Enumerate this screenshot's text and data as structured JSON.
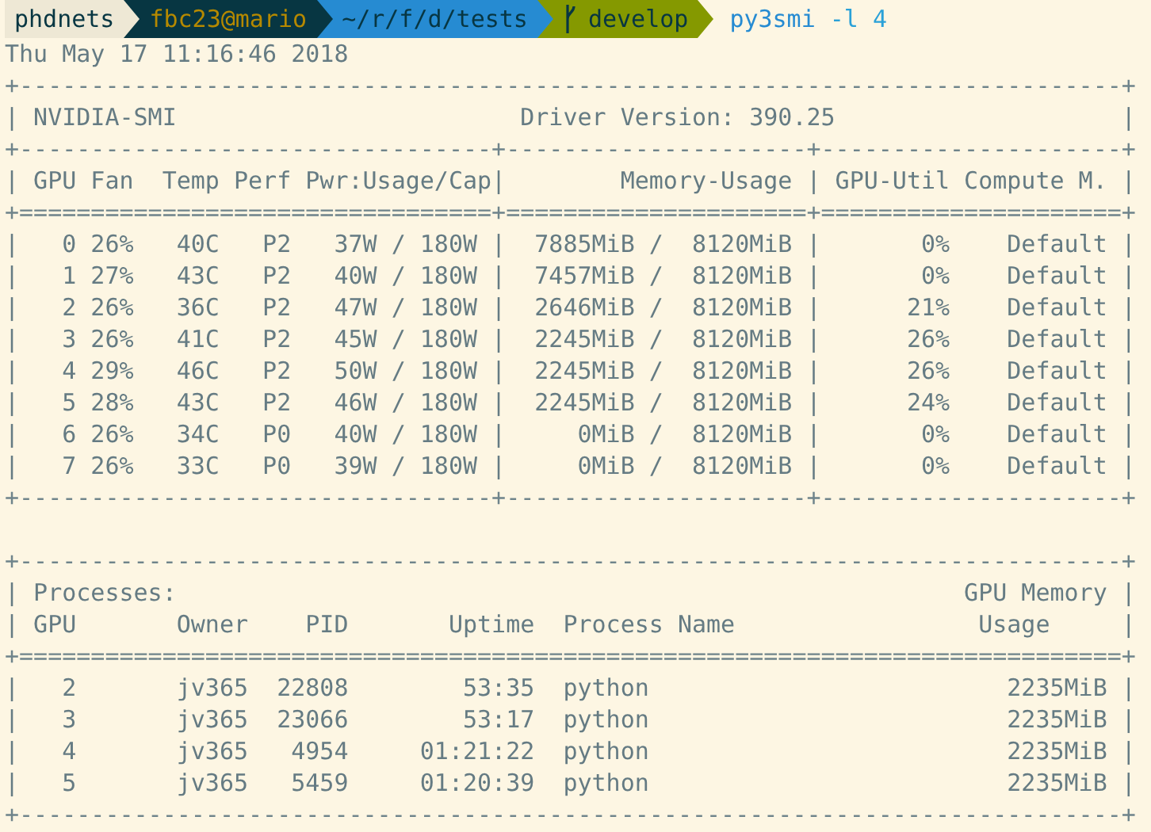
{
  "prompt": {
    "segments": [
      {
        "kind": "host",
        "text": "phdnets",
        "color": "#eee8d5"
      },
      {
        "kind": "user",
        "text": "fbc23@mario",
        "color": "#073642"
      },
      {
        "kind": "path",
        "text": "~/r/f/d/tests",
        "color": "#268bd2"
      },
      {
        "kind": "git",
        "text": "develop",
        "color": "#859900"
      }
    ],
    "command": "py3smi",
    "arguments": "-l 4"
  },
  "date": "Thu May 17 11:16:46 2018",
  "gpu_table": {
    "lines": [
      {
        "kind": "border",
        "text": "+-----------------------------------------------------------------------------+"
      },
      {
        "kind": "row",
        "text": "| NVIDIA-SMI                        Driver Version: 390.25                    |"
      },
      {
        "kind": "border",
        "text": "+---------------------------------+---------------------+---------------------+"
      },
      {
        "kind": "row",
        "text": "| GPU Fan  Temp Perf Pwr:Usage/Cap|        Memory-Usage | GPU-Util Compute M. |"
      },
      {
        "kind": "border",
        "text": "+=================================+=====================+=====================+"
      },
      {
        "kind": "row",
        "text": "|   0 26%   40C   P2   37W / 180W |  7885MiB /  8120MiB |       0%    Default |"
      },
      {
        "kind": "row",
        "text": "|   1 27%   43C   P2   40W / 180W |  7457MiB /  8120MiB |       0%    Default |"
      },
      {
        "kind": "row",
        "text": "|   2 26%   36C   P2   47W / 180W |  2646MiB /  8120MiB |      21%    Default |"
      },
      {
        "kind": "row",
        "text": "|   3 26%   41C   P2   45W / 180W |  2245MiB /  8120MiB |      26%    Default |"
      },
      {
        "kind": "row",
        "text": "|   4 29%   46C   P2   50W / 180W |  2245MiB /  8120MiB |      26%    Default |"
      },
      {
        "kind": "row",
        "text": "|   5 28%   43C   P2   46W / 180W |  2245MiB /  8120MiB |      24%    Default |"
      },
      {
        "kind": "row",
        "text": "|   6 26%   34C   P0   40W / 180W |     0MiB /  8120MiB |       0%    Default |"
      },
      {
        "kind": "row",
        "text": "|   7 26%   33C   P0   39W / 180W |     0MiB /  8120MiB |       0%    Default |"
      },
      {
        "kind": "border",
        "text": "+---------------------------------+---------------------+---------------------+"
      }
    ]
  },
  "process_table": {
    "lines": [
      {
        "kind": "border",
        "text": "+-----------------------------------------------------------------------------+"
      },
      {
        "kind": "row",
        "text": "| Processes:                                                       GPU Memory |"
      },
      {
        "kind": "row",
        "text": "| GPU       Owner    PID       Uptime  Process Name                 Usage     |"
      },
      {
        "kind": "border",
        "text": "+=============================================================================+"
      },
      {
        "kind": "row",
        "text": "|   2       jv365  22808        53:35  python                         2235MiB |"
      },
      {
        "kind": "row",
        "text": "|   3       jv365  23066        53:17  python                         2235MiB |"
      },
      {
        "kind": "row",
        "text": "|   4       jv365   4954     01:21:22  python                         2235MiB |"
      },
      {
        "kind": "row",
        "text": "|   5       jv365   5459     01:20:39  python                         2235MiB |"
      },
      {
        "kind": "border",
        "text": "+-----------------------------------------------------------------------------+"
      }
    ]
  }
}
